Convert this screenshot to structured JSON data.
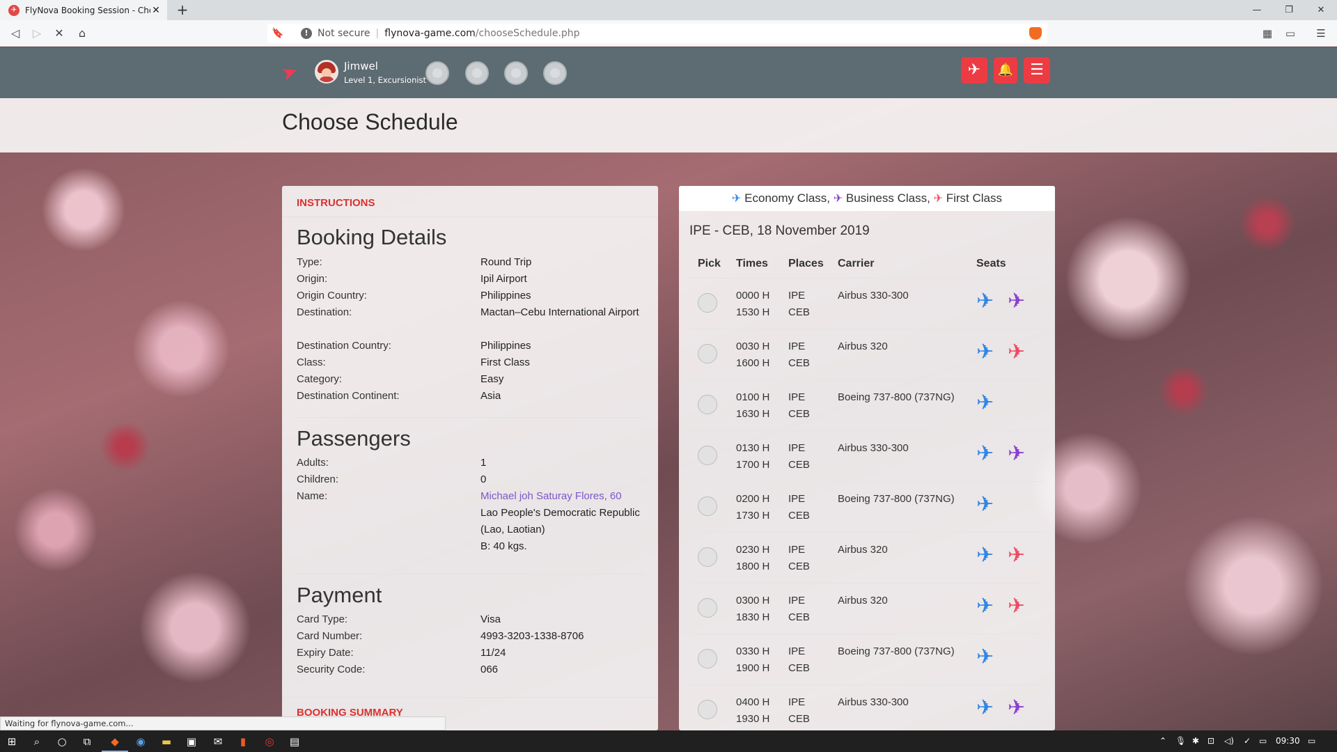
{
  "browser": {
    "tab_title": "FlyNova Booking Session - Choose",
    "tab_favicon": "flynova-favicon",
    "new_tab": "+",
    "not_secure": "Not secure",
    "url_host": "flynova-game.com",
    "url_path": "/chooseSchedule.php",
    "status_text": "Waiting for flynova-game.com..."
  },
  "header": {
    "username": "Jimwel",
    "level": "Level 1, Excursionist",
    "logo_icon": "paper-plane-icon",
    "buttons": [
      "airplane-icon",
      "bell-icon",
      "sliders-icon"
    ]
  },
  "page": {
    "title": "Choose Schedule"
  },
  "left": {
    "instructions": "INSTRUCTIONS",
    "booking_title": "Booking Details",
    "booking": [
      {
        "label": "Type:",
        "value": "Round Trip"
      },
      {
        "label": "Origin:",
        "value": "Ipil Airport"
      },
      {
        "label": "Origin Country:",
        "value": "Philippines"
      },
      {
        "label": "Destination:",
        "value": "Mactan–Cebu International Airport"
      },
      {
        "label": "Destination Country:",
        "value": "Philippines"
      },
      {
        "label": "Class:",
        "value": "First Class"
      },
      {
        "label": "Category:",
        "value": "Easy"
      },
      {
        "label": "Destination Continent:",
        "value": "Asia"
      }
    ],
    "passengers_title": "Passengers",
    "passengers": {
      "adults_label": "Adults:",
      "adults": "1",
      "children_label": "Children:",
      "children": "0",
      "name_label": "Name:",
      "name_link": "Michael joh Saturay Flores, 60",
      "nationality": "Lao People's Democratic Republic (Lao, Laotian)",
      "baggage": "B: 40 kgs."
    },
    "payment_title": "Payment",
    "payment": [
      {
        "label": "Card Type:",
        "value": "Visa"
      },
      {
        "label": "Card Number:",
        "value": "4993-3203-1338-8706"
      },
      {
        "label": "Expiry Date:",
        "value": "11/24"
      },
      {
        "label": "Security Code:",
        "value": "066"
      }
    ],
    "booking_summary": "BOOKING SUMMARY"
  },
  "right": {
    "legend": {
      "economy": "Economy Class,",
      "business": "Business Class,",
      "first": "First Class"
    },
    "colors": {
      "economy": "#2f86e6",
      "business": "#8a3fd1",
      "first": "#ee4a63"
    },
    "route": "IPE - CEB, 18 November 2019",
    "headers": [
      "Pick",
      "Times",
      "Places",
      "Carrier",
      "Seats"
    ],
    "flights": [
      {
        "dep": "0000 H",
        "arr": "1530 H",
        "from": "IPE",
        "to": "CEB",
        "carrier": "Airbus 330-300",
        "seats": [
          "economy",
          "business"
        ]
      },
      {
        "dep": "0030 H",
        "arr": "1600 H",
        "from": "IPE",
        "to": "CEB",
        "carrier": "Airbus 320",
        "seats": [
          "economy",
          "first"
        ]
      },
      {
        "dep": "0100 H",
        "arr": "1630 H",
        "from": "IPE",
        "to": "CEB",
        "carrier": "Boeing 737-800 (737NG)",
        "seats": [
          "economy"
        ]
      },
      {
        "dep": "0130 H",
        "arr": "1700 H",
        "from": "IPE",
        "to": "CEB",
        "carrier": "Airbus 330-300",
        "seats": [
          "economy",
          "business"
        ]
      },
      {
        "dep": "0200 H",
        "arr": "1730 H",
        "from": "IPE",
        "to": "CEB",
        "carrier": "Boeing 737-800 (737NG)",
        "seats": [
          "economy"
        ]
      },
      {
        "dep": "0230 H",
        "arr": "1800 H",
        "from": "IPE",
        "to": "CEB",
        "carrier": "Airbus 320",
        "seats": [
          "economy",
          "first"
        ]
      },
      {
        "dep": "0300 H",
        "arr": "1830 H",
        "from": "IPE",
        "to": "CEB",
        "carrier": "Airbus 320",
        "seats": [
          "economy",
          "first"
        ]
      },
      {
        "dep": "0330 H",
        "arr": "1900 H",
        "from": "IPE",
        "to": "CEB",
        "carrier": "Boeing 737-800 (737NG)",
        "seats": [
          "economy"
        ]
      },
      {
        "dep": "0400 H",
        "arr": "1930 H",
        "from": "IPE",
        "to": "CEB",
        "carrier": "Airbus 330-300",
        "seats": [
          "economy",
          "business"
        ]
      }
    ]
  },
  "taskbar": {
    "clock": "09:30"
  }
}
